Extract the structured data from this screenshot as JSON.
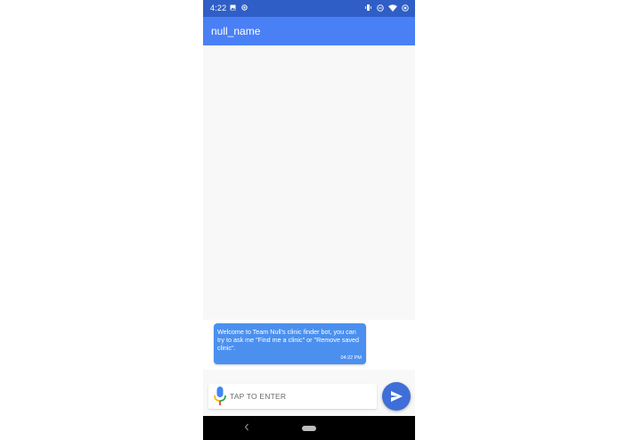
{
  "status_bar": {
    "time": "4:22",
    "icons_left": [
      "image-icon",
      "location-icon"
    ],
    "icons_right": [
      "vibrate-icon",
      "do-not-disturb-icon",
      "wifi-icon",
      "battery-icon"
    ]
  },
  "app_bar": {
    "title": "null_name"
  },
  "messages": [
    {
      "sender": "bot",
      "text": "Welcome to Team Null's clinic finder bot, you can try to ask me \"Find me a clinic\" or \"Remove saved clinic\".",
      "time": "04:22 PM"
    }
  ],
  "input": {
    "placeholder": "TAP TO ENTER",
    "value": ""
  },
  "colors": {
    "status_bar": "#2f5fc6",
    "app_bar": "#4a80f5",
    "bubble": "#4b90ef",
    "send_button": "#3f6ed8"
  }
}
